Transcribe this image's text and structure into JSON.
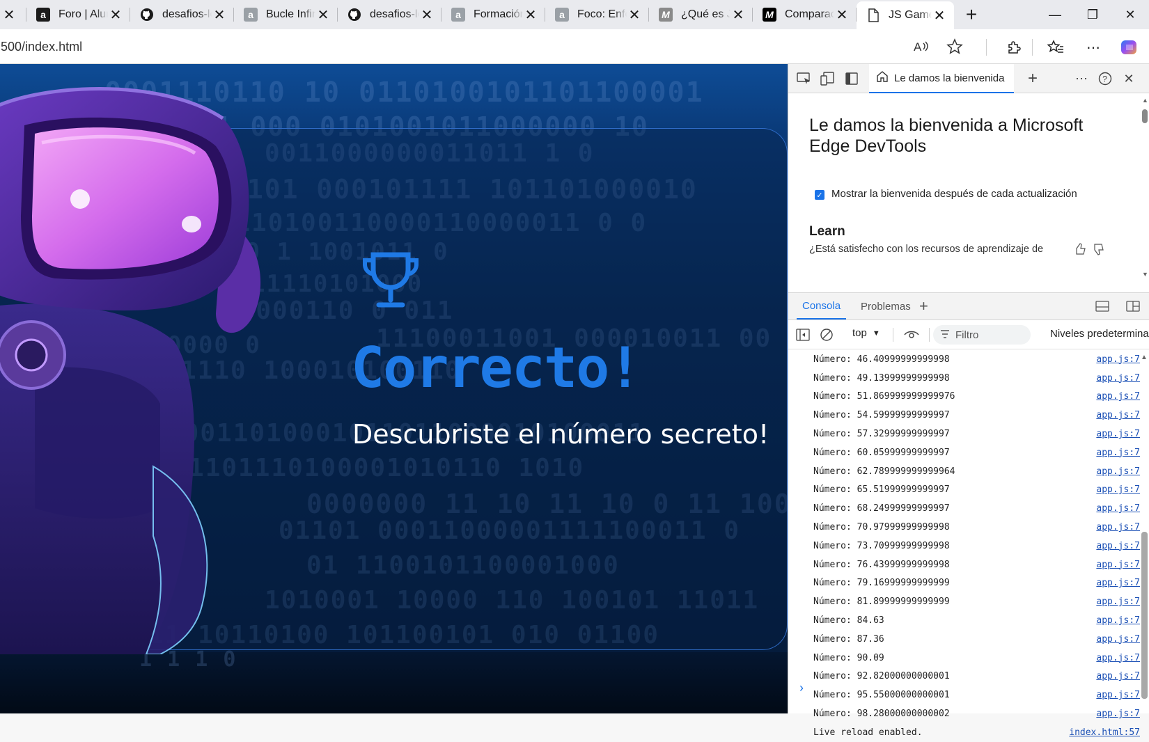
{
  "browser": {
    "tabs": [
      {
        "title": "",
        "icon": "page-icon",
        "partial": true
      },
      {
        "title": "Foro | Alura",
        "icon": "alura-icon",
        "style": "alura-dark"
      },
      {
        "title": "desafios-lo",
        "icon": "github-icon",
        "style": "gh"
      },
      {
        "title": "Bucle Infini",
        "icon": "alura-icon",
        "style": "alura"
      },
      {
        "title": "desafios-lo",
        "icon": "github-icon",
        "style": "gh"
      },
      {
        "title": "Formación",
        "icon": "alura-icon",
        "style": "alura"
      },
      {
        "title": "Foco: Enfo",
        "icon": "alura-icon",
        "style": "alura"
      },
      {
        "title": "¿Qué es Ja",
        "icon": "m-icon",
        "style": "m"
      },
      {
        "title": "Comparaci",
        "icon": "m-icon",
        "style": "m-dark"
      },
      {
        "title": "JS Game",
        "icon": "page-icon",
        "style": "page",
        "active": true
      }
    ],
    "address": "500/index.html"
  },
  "page": {
    "headline": "Correcto!",
    "subtitle": "Descubriste el número secreto!",
    "binary_lines": [
      "0001110110 10 0110100101101100001",
      "0 1 000 0101001011000000 10",
      "0011000000011011 1 0",
      "1101 000101111 101101000010",
      "00110100110000110000011 0 0",
      "10 1 1001011 0",
      "11110101000",
      "10000110 0 011",
      "0000 0",
      "1110 100010100110",
      "11100011001 000010011 00",
      "00011010001011011000010100011",
      "1001101110100001010110 1010",
      "0000000 11 10 11 10 0 11 100",
      "01101 00011000001111100011 0",
      "01 1100101100001000",
      "1010001 10000 110 100101 11011",
      "0100 010 11 10110100 101100101 010 01100",
      "1 1 1 0"
    ]
  },
  "devtools": {
    "welcome_tab": "Le damos la bienvenida",
    "welcome_title": "Le damos la bienvenida a Microsoft Edge DevTools",
    "welcome_checkbox": "Mostrar la bienvenida después de cada actualización",
    "learn_heading": "Learn",
    "learn_text": "¿Está satisfecho con los recursos de aprendizaje de",
    "panel_tabs": [
      "Consola",
      "Problemas"
    ],
    "context": "top",
    "filter_placeholder": "Filtro",
    "levels": "Niveles predetermina",
    "logs": [
      {
        "msg": "Número: 46.40999999999998",
        "src": "app.js:7"
      },
      {
        "msg": "Número: 49.13999999999998",
        "src": "app.js:7"
      },
      {
        "msg": "Número: 51.869999999999976",
        "src": "app.js:7"
      },
      {
        "msg": "Número: 54.59999999999997",
        "src": "app.js:7"
      },
      {
        "msg": "Número: 57.32999999999997",
        "src": "app.js:7"
      },
      {
        "msg": "Número: 60.05999999999997",
        "src": "app.js:7"
      },
      {
        "msg": "Número: 62.789999999999964",
        "src": "app.js:7"
      },
      {
        "msg": "Número: 65.51999999999997",
        "src": "app.js:7"
      },
      {
        "msg": "Número: 68.24999999999997",
        "src": "app.js:7"
      },
      {
        "msg": "Número: 70.97999999999998",
        "src": "app.js:7"
      },
      {
        "msg": "Número: 73.70999999999998",
        "src": "app.js:7"
      },
      {
        "msg": "Número: 76.43999999999998",
        "src": "app.js:7"
      },
      {
        "msg": "Número: 79.16999999999999",
        "src": "app.js:7"
      },
      {
        "msg": "Número: 81.89999999999999",
        "src": "app.js:7"
      },
      {
        "msg": "Número: 84.63",
        "src": "app.js:7"
      },
      {
        "msg": "Número: 87.36",
        "src": "app.js:7"
      },
      {
        "msg": "Número: 90.09",
        "src": "app.js:7"
      },
      {
        "msg": "Número: 92.82000000000001",
        "src": "app.js:7"
      },
      {
        "msg": "Número: 95.55000000000001",
        "src": "app.js:7"
      },
      {
        "msg": "Número: 98.28000000000002",
        "src": "app.js:7"
      },
      {
        "msg": "Live reload enabled.",
        "src": "index.html:57"
      }
    ]
  },
  "colors": {
    "accent": "#1f7ae6",
    "devtools_accent": "#1a73e8",
    "link": "#1a4fb5"
  }
}
